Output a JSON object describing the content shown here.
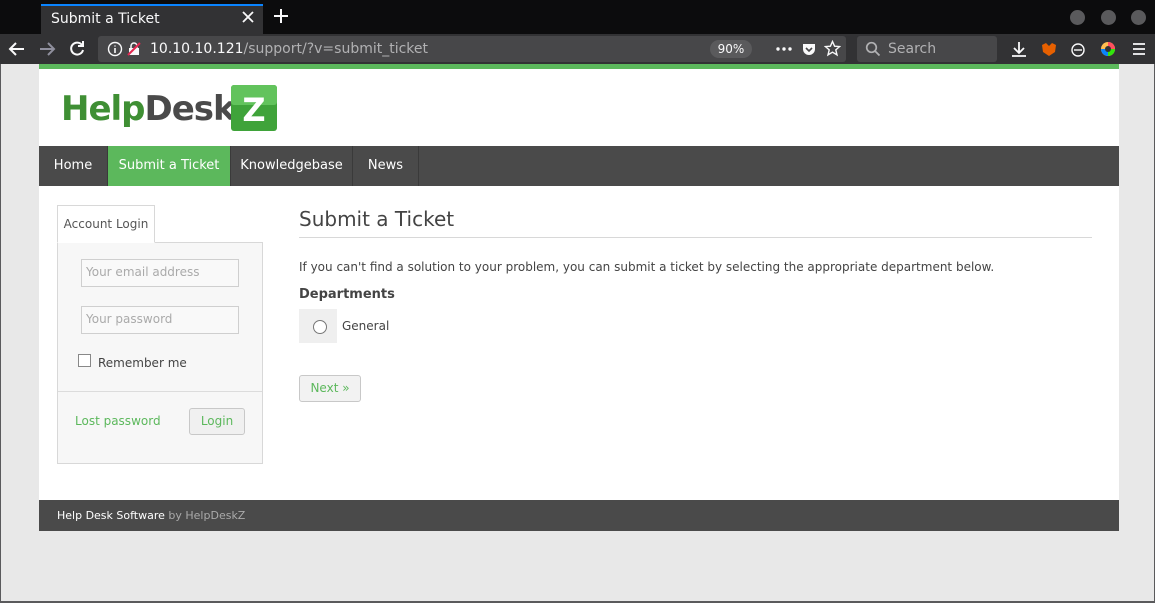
{
  "browser": {
    "tab_title": "Submit a Ticket",
    "url_host": "10.10.10.121",
    "url_path": "/support/?v=submit_ticket",
    "zoom": "90%",
    "search_placeholder": "Search",
    "accent_color": "#0a84ff"
  },
  "site": {
    "logo_text": "HelpDeskZ",
    "brand_color": "#5cb85c",
    "menu": [
      {
        "label": "Home",
        "active": false
      },
      {
        "label": "Submit a Ticket",
        "active": true
      },
      {
        "label": "Knowledgebase",
        "active": false
      },
      {
        "label": "News",
        "active": false
      }
    ]
  },
  "login": {
    "tab_label": "Account Login",
    "email_placeholder": "Your email address",
    "password_placeholder": "Your password",
    "remember_label": "Remember me",
    "lost_password": "Lost password",
    "login_button": "Login"
  },
  "main": {
    "title": "Submit a Ticket",
    "intro": "If you can't find a solution to your problem, you can submit a ticket by selecting the appropriate department below.",
    "departments_heading": "Departments",
    "departments": [
      {
        "label": "General",
        "selected": false
      }
    ],
    "next_button": "Next »"
  },
  "footer": {
    "text": "Help Desk Software",
    "by_text": "by HelpDeskZ"
  }
}
